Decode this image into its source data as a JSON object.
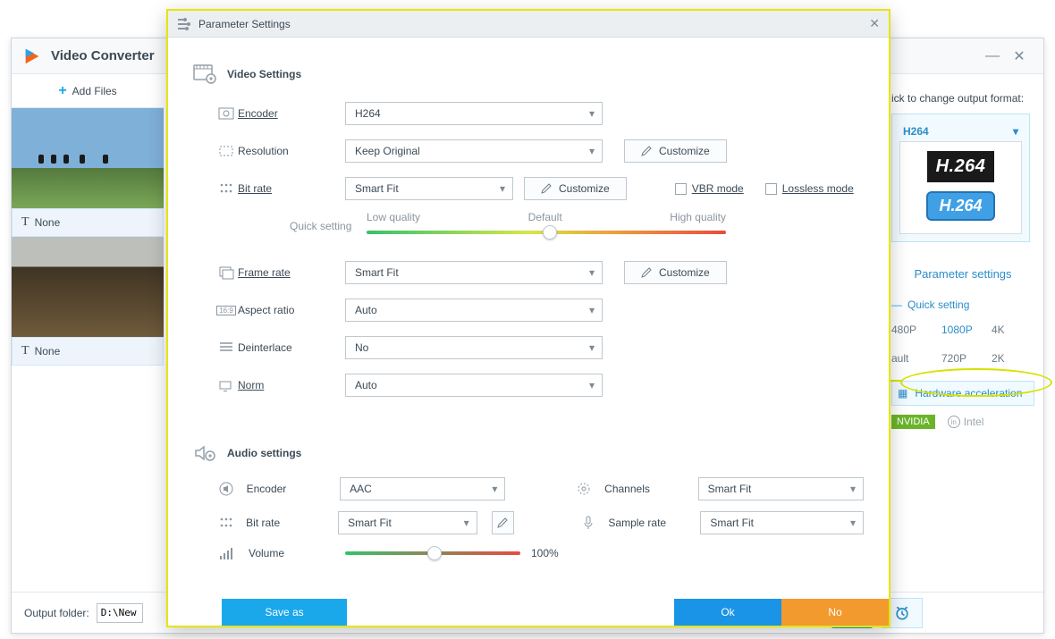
{
  "app": {
    "title": "Video Converter",
    "add_files": "Add Files",
    "subtitle_none": "None",
    "output_folder_label": "Output folder:",
    "output_folder_value": "D:\\New f",
    "right": {
      "hint": "ick to change output format:",
      "format_label": "H264",
      "h264_big": "H.264",
      "h264_tag": "H.264",
      "parameter_settings": "Parameter settings",
      "quick_setting": "Quick setting",
      "res": [
        "480P",
        "1080P",
        "4K",
        "ault",
        "720P",
        "2K"
      ],
      "hw_accel": "Hardware acceleration",
      "gpu_nvidia": "NVIDIA",
      "gpu_intel": "Intel"
    }
  },
  "modal": {
    "title": "Parameter Settings",
    "video": {
      "section": "Video Settings",
      "encoder_label": "Encoder",
      "encoder_value": "H264",
      "resolution_label": "Resolution",
      "resolution_value": "Keep Original",
      "customize": "Customize",
      "bitrate_label": "Bit rate",
      "bitrate_value": "Smart Fit",
      "vbr_mode": "VBR mode",
      "lossless_mode": "Lossless mode",
      "quick_setting": "Quick setting",
      "low_q": "Low quality",
      "default_q": "Default",
      "high_q": "High quality",
      "framerate_label": "Frame rate",
      "framerate_value": "Smart Fit",
      "aspect_label": "Aspect ratio",
      "aspect_value": "Auto",
      "deinterlace_label": "Deinterlace",
      "deinterlace_value": "No",
      "norm_label": "Norm",
      "norm_value": "Auto"
    },
    "audio": {
      "section": "Audio settings",
      "encoder_label": "Encoder",
      "encoder_value": "AAC",
      "channels_label": "Channels",
      "channels_value": "Smart Fit",
      "bitrate_label": "Bit rate",
      "bitrate_value": "Smart Fit",
      "samplerate_label": "Sample rate",
      "samplerate_value": "Smart Fit",
      "volume_label": "Volume",
      "volume_pct": "100%"
    },
    "footer": {
      "save_as": "Save as",
      "ok": "Ok",
      "no": "No"
    }
  }
}
